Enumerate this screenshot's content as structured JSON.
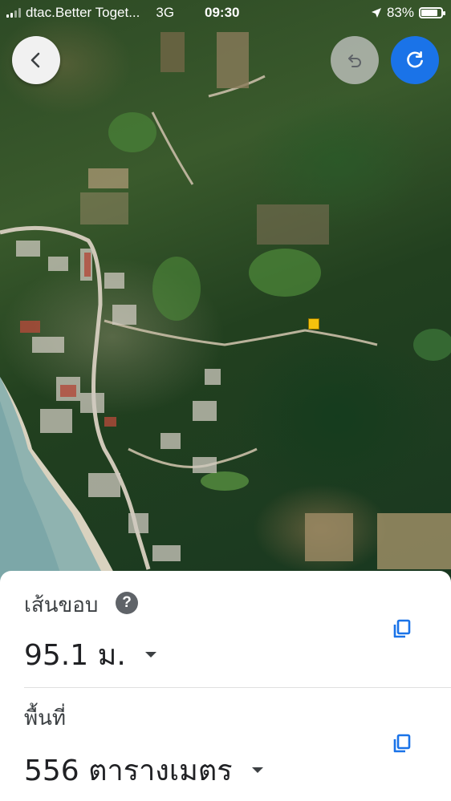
{
  "status_bar": {
    "carrier": "dtac.Better Toget...",
    "network": "3G",
    "time": "09:30",
    "battery_percent": "83%",
    "battery_level": 0.83
  },
  "toolbar": {
    "back_icon": "chevron-left-icon",
    "undo_icon": "undo-icon",
    "redo_icon": "redo-icon",
    "accent_color": "#1a73e8"
  },
  "measure": {
    "perimeter_label": "เส้นขอบ",
    "help_symbol": "?",
    "perimeter_value": "95.1 ม.",
    "area_label": "พื้นที่",
    "area_value": "556 ตารางเมตร",
    "copy_icon": "copy-icon"
  }
}
